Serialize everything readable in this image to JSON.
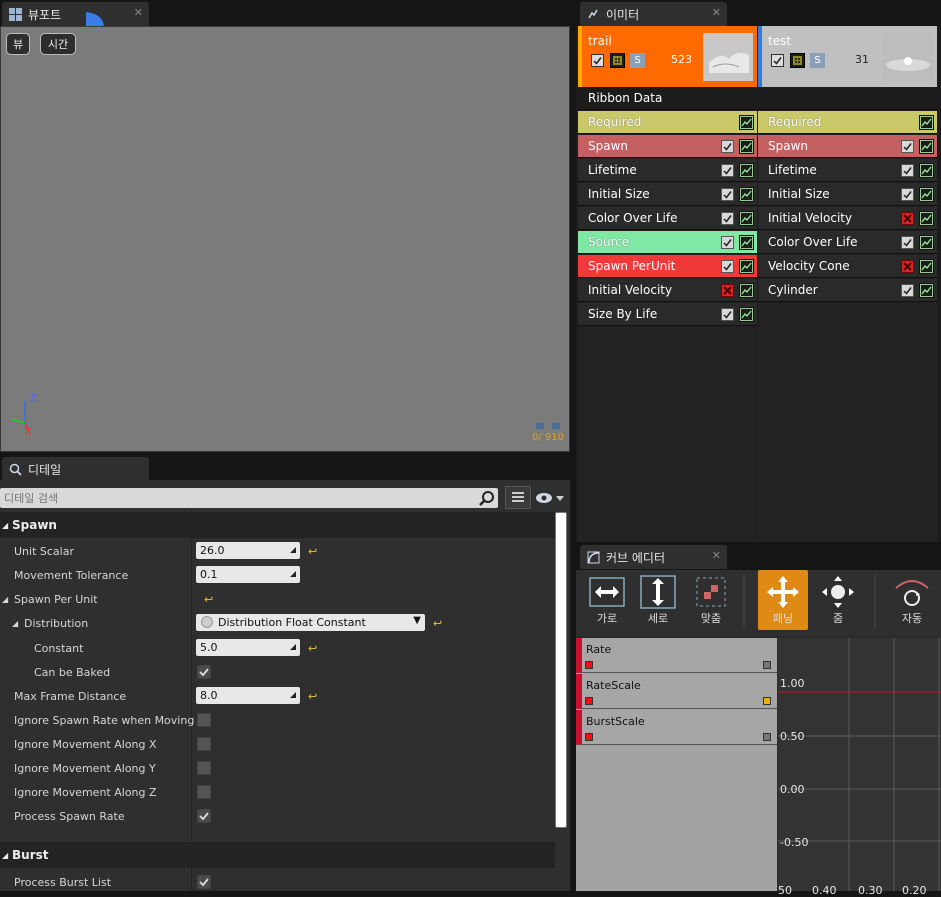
{
  "viewport_tab": {
    "title": "뷰포트"
  },
  "viewport": {
    "view_btn": "뷰",
    "time_btn": "시간",
    "axis_z": "Z",
    "axis_x": "X",
    "counter": "0/ 910"
  },
  "emitters_tab": {
    "title": "이미터"
  },
  "emitters": [
    {
      "name": "trail",
      "count": "523",
      "accent": "#ff6a00",
      "s_label": "S",
      "modules": [
        {
          "label": "Ribbon Data",
          "bg": "#1c1c1c",
          "cb": "none",
          "graph": false
        },
        {
          "label": "Required",
          "bg": "#c9c96a",
          "cb": "none",
          "graph": true
        },
        {
          "label": "Spawn",
          "bg": "#c56062",
          "cb": "on",
          "graph": true
        },
        {
          "label": "Lifetime",
          "bg": "#2a2a2a",
          "cb": "on",
          "graph": true
        },
        {
          "label": "Initial Size",
          "bg": "#2a2a2a",
          "cb": "on",
          "graph": true
        },
        {
          "label": "Color Over Life",
          "bg": "#2a2a2a",
          "cb": "on",
          "graph": true
        },
        {
          "label": "Source",
          "bg": "#7fe8a5",
          "cb": "on",
          "graph": true
        },
        {
          "label": "Spawn PerUnit",
          "bg": "#f03a3a",
          "cb": "on",
          "graph": true
        },
        {
          "label": "Initial Velocity",
          "bg": "#2a2a2a",
          "cb": "off",
          "graph": true
        },
        {
          "label": "Size By Life",
          "bg": "#2a2a2a",
          "cb": "on",
          "graph": true
        }
      ]
    },
    {
      "name": "test",
      "count": "31",
      "accent": "#2a7de1",
      "s_label": "S",
      "modules": [
        {
          "label": "",
          "bg": "#1c1c1c",
          "cb": "none",
          "graph": false
        },
        {
          "label": "Required",
          "bg": "#c9c96a",
          "cb": "none",
          "graph": true
        },
        {
          "label": "Spawn",
          "bg": "#c56062",
          "cb": "on",
          "graph": true
        },
        {
          "label": "Lifetime",
          "bg": "#2a2a2a",
          "cb": "on",
          "graph": true
        },
        {
          "label": "Initial Size",
          "bg": "#2a2a2a",
          "cb": "on",
          "graph": true
        },
        {
          "label": "Initial Velocity",
          "bg": "#2a2a2a",
          "cb": "off",
          "graph": true
        },
        {
          "label": "Color Over Life",
          "bg": "#2a2a2a",
          "cb": "on",
          "graph": true
        },
        {
          "label": "Velocity Cone",
          "bg": "#2a2a2a",
          "cb": "off",
          "graph": true
        },
        {
          "label": "Cylinder",
          "bg": "#2a2a2a",
          "cb": "on",
          "graph": true
        }
      ]
    }
  ],
  "details_tab": {
    "title": "디테일"
  },
  "details": {
    "search_placeholder": "디테일 검색",
    "spawn_category": "Spawn",
    "unit_scalar": {
      "label": "Unit Scalar",
      "value": "26.0"
    },
    "movement_tolerance": {
      "label": "Movement Tolerance",
      "value": "0.1"
    },
    "spawn_per_unit": {
      "label": "Spawn Per Unit"
    },
    "distribution": {
      "label": "Distribution",
      "value": "Distribution Float Constant"
    },
    "constant": {
      "label": "Constant",
      "value": "5.0"
    },
    "can_be_baked": {
      "label": "Can be Baked",
      "checked": true
    },
    "max_frame_distance": {
      "label": "Max Frame Distance",
      "value": "8.0"
    },
    "ignore_spawn_rate": {
      "label": "Ignore Spawn Rate when Moving",
      "checked": false
    },
    "ignore_x": {
      "label": "Ignore Movement Along X",
      "checked": false
    },
    "ignore_y": {
      "label": "Ignore Movement Along Y",
      "checked": false
    },
    "ignore_z": {
      "label": "Ignore Movement Along Z",
      "checked": false
    },
    "process_spawn_rate": {
      "label": "Process Spawn Rate",
      "checked": true
    },
    "burst_category": "Burst",
    "process_burst_list": {
      "label": "Process Burst List",
      "checked": true
    }
  },
  "curve_tab": {
    "title": "커브 에디터"
  },
  "curve_toolbar": [
    {
      "label": "가로",
      "icon": "fit-horizontal-icon"
    },
    {
      "label": "세로",
      "icon": "fit-vertical-icon"
    },
    {
      "label": "맞춤",
      "icon": "fit-selected-icon"
    },
    {
      "label": "패닝",
      "icon": "pan-icon",
      "active": true
    },
    {
      "label": "줌",
      "icon": "zoom-icon"
    },
    {
      "label": "자동",
      "icon": "auto-icon"
    }
  ],
  "curves": [
    {
      "name": "Rate",
      "end_color": "#777777"
    },
    {
      "name": "RateScale",
      "end_color": "#e8b400"
    },
    {
      "name": "BurstScale",
      "end_color": "#777777"
    }
  ],
  "graph": {
    "y_labels": [
      "1.00",
      "0.50",
      "0.00",
      "-0.50"
    ],
    "x_labels": [
      "50",
      "0.40",
      "0.30",
      "0.20"
    ],
    "line_color": "#c8102e"
  }
}
